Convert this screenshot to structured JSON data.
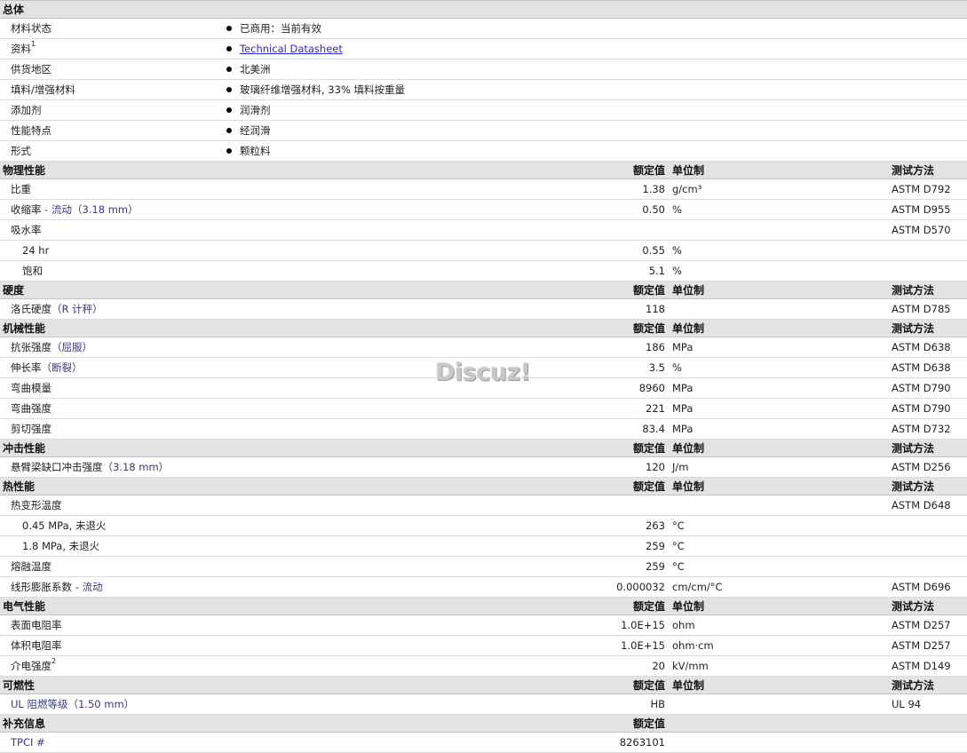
{
  "general": {
    "header": "总体",
    "rows": [
      {
        "label": "材料状态",
        "value": "已商用：当前有效"
      },
      {
        "label": "资料",
        "sup": "1",
        "value": "Technical Datasheet",
        "link": true
      },
      {
        "label": "供货地区",
        "value": "北美洲"
      },
      {
        "label": "填料/增强材料",
        "value": "玻璃纤维增强材料, 33% 填料按重量"
      },
      {
        "label": "添加剂",
        "value": "润滑剂"
      },
      {
        "label": "性能特点",
        "value": "经润滑"
      },
      {
        "label": "形式",
        "value": "颗粒料"
      }
    ]
  },
  "columns": {
    "nominal": "额定值",
    "unit": "单位制",
    "method": "测试方法"
  },
  "sections": [
    {
      "title": "物理性能",
      "rows": [
        {
          "name": "比重",
          "value": "1.38",
          "unit": "g/cm³",
          "method": "ASTM D792"
        },
        {
          "name": "收缩率",
          "cond": " - 流动（3.18 mm）",
          "value": "0.50",
          "unit": "%",
          "method": "ASTM D955"
        },
        {
          "name": "吸水率",
          "method": "ASTM D570"
        },
        {
          "name": "24 hr",
          "sub": true,
          "value": "0.55",
          "unit": "%"
        },
        {
          "name": "饱和",
          "sub": true,
          "value": "5.1",
          "unit": "%"
        }
      ]
    },
    {
      "title": "硬度",
      "rows": [
        {
          "name": "洛氏硬度",
          "cond": "（R 计秤）",
          "value": "118",
          "method": "ASTM D785"
        }
      ]
    },
    {
      "title": "机械性能",
      "rows": [
        {
          "name": "抗张强度",
          "cond": "（屈服）",
          "value": "186",
          "unit": "MPa",
          "method": "ASTM D638"
        },
        {
          "name": "伸长率",
          "cond": "（断裂）",
          "value": "3.5",
          "unit": "%",
          "method": "ASTM D638"
        },
        {
          "name": "弯曲模量",
          "value": "8960",
          "unit": "MPa",
          "method": "ASTM D790"
        },
        {
          "name": "弯曲强度",
          "value": "221",
          "unit": "MPa",
          "method": "ASTM D790"
        },
        {
          "name": "剪切强度",
          "value": "83.4",
          "unit": "MPa",
          "method": "ASTM D732"
        }
      ]
    },
    {
      "title": "冲击性能",
      "rows": [
        {
          "name": "悬臂梁缺口冲击强度",
          "cond": "（3.18 mm）",
          "value": "120",
          "unit": "J/m",
          "method": "ASTM D256"
        }
      ]
    },
    {
      "title": "热性能",
      "rows": [
        {
          "name": "热变形温度",
          "method": "ASTM D648"
        },
        {
          "name": "0.45 MPa, 未退火",
          "sub": true,
          "value": "263",
          "unit": "°C"
        },
        {
          "name": "1.8 MPa, 未退火",
          "sub": true,
          "value": "259",
          "unit": "°C"
        },
        {
          "name": "熔融温度",
          "value": "259",
          "unit": "°C"
        },
        {
          "name": "线形膨胀系数",
          "cond": " - 流动",
          "value": "0.000032",
          "unit": "cm/cm/°C",
          "method": "ASTM D696"
        }
      ]
    },
    {
      "title": "电气性能",
      "rows": [
        {
          "name": "表面电阻率",
          "value": "1.0E+15",
          "unit": "ohm",
          "method": "ASTM D257"
        },
        {
          "name": "体积电阻率",
          "value": "1.0E+15",
          "unit": "ohm·cm",
          "method": "ASTM D257"
        },
        {
          "name": "介电强度",
          "sup": "2",
          "value": "20",
          "unit": "kV/mm",
          "method": "ASTM D149"
        }
      ]
    },
    {
      "title": "可燃性",
      "rows": [
        {
          "name": "UL 阻燃等级",
          "cond": "（1.50 mm）",
          "value": "HB",
          "method": "UL 94",
          "muted_name": true
        }
      ]
    },
    {
      "title": "补充信息",
      "nominal_only": true,
      "rows": [
        {
          "name": "TPCI #",
          "value": "8263101",
          "muted_name": true
        }
      ]
    }
  ],
  "watermark": "Discuz!"
}
